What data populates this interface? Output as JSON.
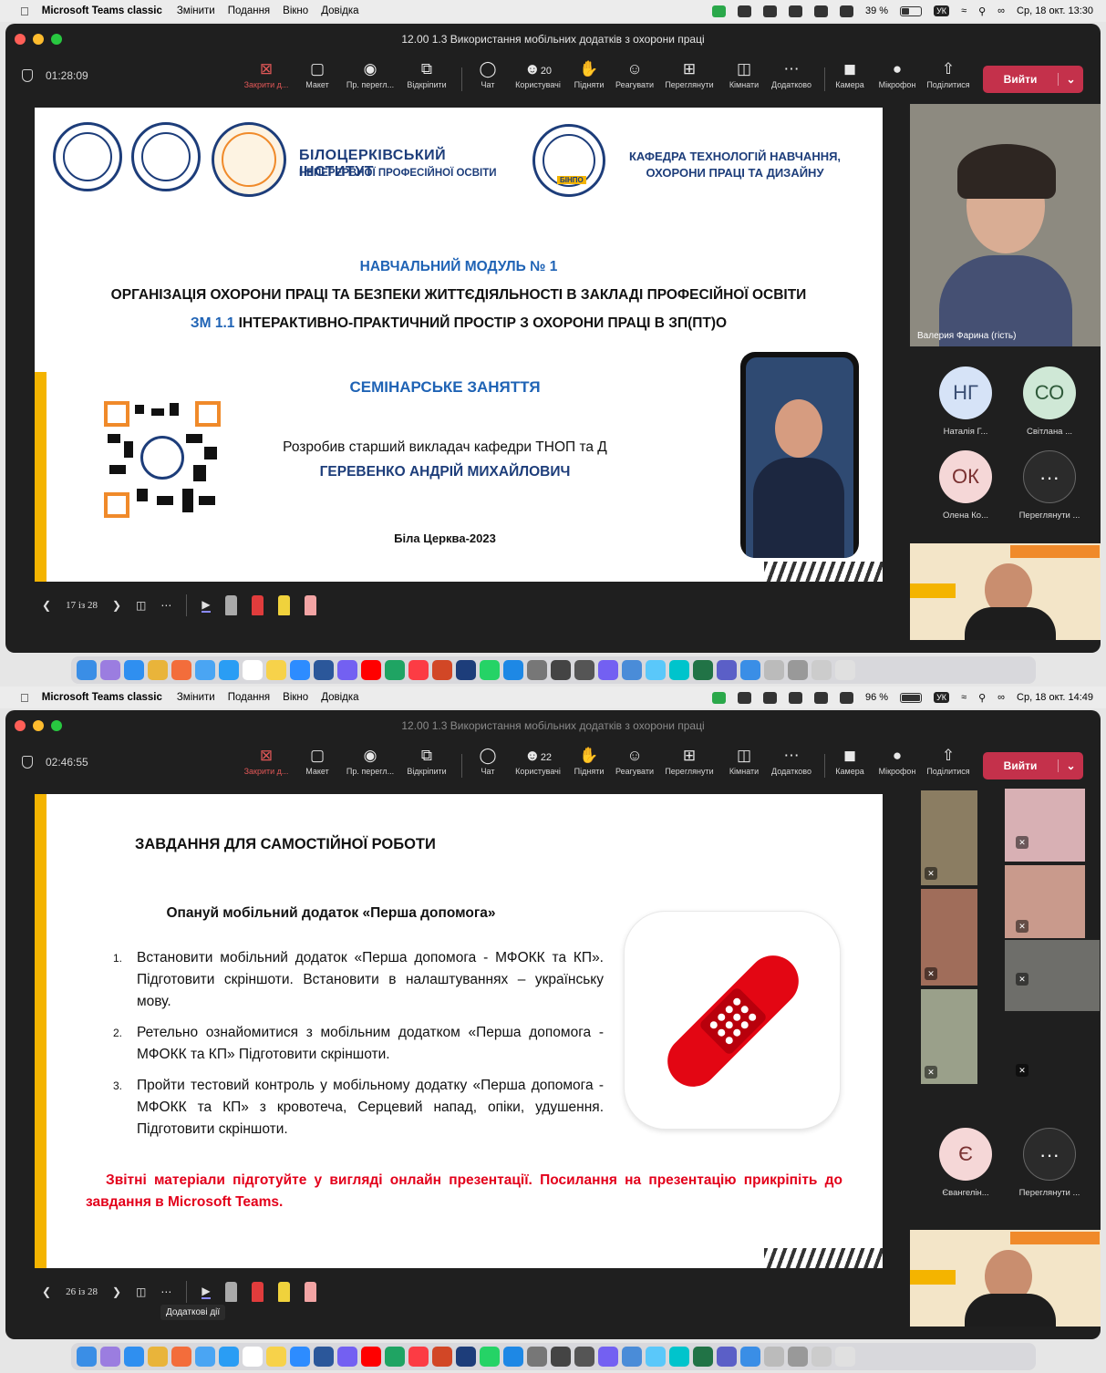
{
  "menubar": {
    "app": "Microsoft Teams classic",
    "items": [
      "Змінити",
      "Подання",
      "Вікно",
      "Довідка"
    ]
  },
  "toolbar": {
    "buttons": [
      "Закрити д...",
      "Макет",
      "Пр. перегл...",
      "Відкріпити",
      "Чат",
      "Користувачі",
      "Підняти",
      "Реагувати",
      "Переглянути",
      "Кімнати",
      "Додатково",
      "Камера",
      "Мікрофон",
      "Поділитися"
    ],
    "leave": "Вийти"
  },
  "shot1": {
    "battery": "39 %",
    "clock": "Ср, 18 окт. 13:30",
    "window_title": "12.00 1.3 Використання мобільних додатків з охорони праці",
    "timer": "01:28:09",
    "participants_count": "20",
    "slide": {
      "institute_line1": "БІЛОЦЕРКІВСЬКИЙ ІНСТИТУТ",
      "institute_line2": "НЕПЕРЕРВНОЇ ПРОФЕСІЙНОЇ ОСВІТИ",
      "logo_text": "БІНПО",
      "dept_line1": "КАФЕДРА ТЕХНОЛОГІЙ НАВЧАННЯ,",
      "dept_line2": "ОХОРОНИ ПРАЦІ ТА ДИЗАЙНУ",
      "module": "НАВЧАЛЬНИЙ МОДУЛЬ № 1",
      "heading": "ОРГАНІЗАЦІЯ ОХОРОНИ ПРАЦІ ТА БЕЗПЕКИ ЖИТТЄДІЯЛЬНОСТІ В ЗАКЛАДІ ПРОФЕСІЙНОЇ ОСВІТИ",
      "zm_prefix": "ЗМ 1.1",
      "zm_text": " ІНТЕРАКТИВНО-ПРАКТИЧНИЙ ПРОСТІР З ОХОРОНИ ПРАЦІ В ЗП(ПТ)О",
      "seminar": "СЕМІНАРСЬКЕ ЗАНЯТТЯ",
      "author_line": "Розробив старший викладач кафедри ТНОП та Д",
      "author_name": "ГЕРЕВЕНКО АНДРІЙ МИХАЙЛОВИЧ",
      "city": "Біла Церква-2023"
    },
    "page": "17 із 28",
    "speaker": "Валерия Фарина (гість)",
    "avatars": [
      {
        "initials": "НГ",
        "label": "Наталія Г...",
        "bg": "#d6e3f7",
        "fg": "#3b4f74"
      },
      {
        "initials": "СО",
        "label": "Світлана ...",
        "bg": "#cfe8d6",
        "fg": "#2f5a3a"
      },
      {
        "initials": "ОК",
        "label": "Олена Ко...",
        "bg": "#f5d7d7",
        "fg": "#7a3131"
      },
      {
        "initials": "···",
        "label": "Переглянути ...",
        "bg": "#2b2b2b",
        "fg": "#ffffff"
      }
    ]
  },
  "shot2": {
    "battery": "96 %",
    "clock": "Ср, 18 окт. 14:49",
    "window_title": "12.00 1.3 Використання мобільних додатків з охорони праці",
    "timer": "02:46:55",
    "participants_count": "22",
    "slide": {
      "title": "ЗАВДАННЯ ДЛЯ САМОСТІЙНОЇ РОБОТИ",
      "subtitle": "Опануй мобільний додаток «Перша допомога»",
      "tasks": [
        "Встановити мобільний додаток «Перша допомога - МФОКК та КП». Підготовити скріншоти. Встановити в налаштуваннях – українську мову.",
        "Ретельно ознайомитися з мобільним додатком «Перша допомога - МФОКК та КП» Підготовити скріншоти.",
        "Пройти тестовий контроль у мобільному додатку «Перша допомога - МФОКК та КП» з кровотеча, Серцевий напад, опіки, удушення. Підготовити скріншоти."
      ],
      "report": "Звітні матеріали підготуйте у вигляді онлайн презентації. Посилання на презентацію прикріпіть до завдання в Microsoft Teams."
    },
    "page": "26 із 28",
    "tooltip": "Додаткові дії",
    "avatars": [
      {
        "initials": "Є",
        "label": "Євангелін...",
        "bg": "#f5d7d7",
        "fg": "#7a3131"
      },
      {
        "initials": "···",
        "label": "Переглянути ...",
        "bg": "#2b2b2b",
        "fg": "#ffffff"
      }
    ]
  },
  "colors": {
    "accent": "#1f63b5",
    "leave": "#c4314b",
    "report": "#e3001b",
    "band": "#f4b400"
  }
}
